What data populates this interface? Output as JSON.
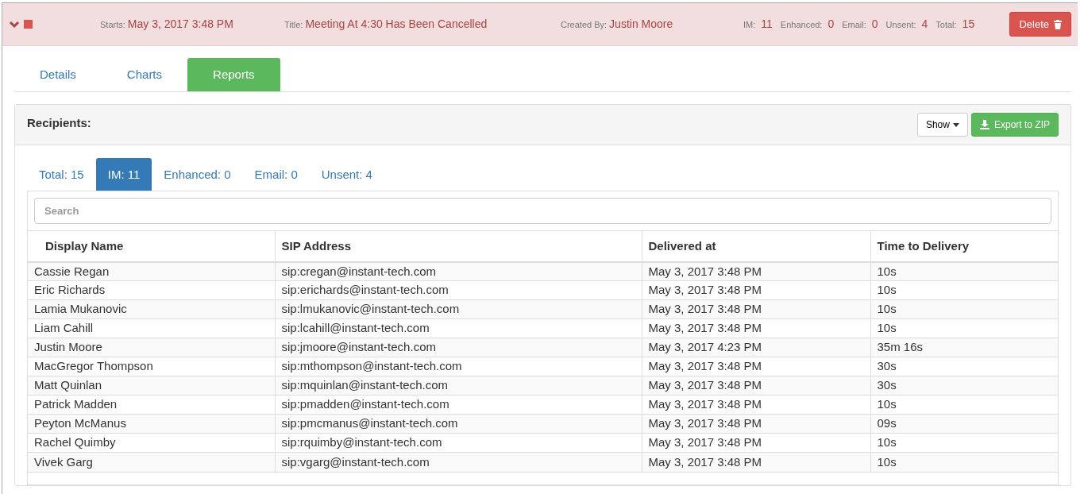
{
  "header": {
    "expanded": true,
    "fields": [
      {
        "label": "Starts:",
        "value": "May 3, 2017 3:48 PM"
      },
      {
        "label": "Title:",
        "value": "Meeting At 4:30 Has Been Cancelled"
      },
      {
        "label": "Created By:",
        "value": "Justin Moore"
      }
    ],
    "counts": [
      {
        "label": "IM:",
        "value": "11"
      },
      {
        "label": "Enhanced:",
        "value": "0"
      },
      {
        "label": "Email:",
        "value": "0"
      },
      {
        "label": "Unsent:",
        "value": "4"
      },
      {
        "label": "Total:",
        "value": "15"
      }
    ],
    "delete_button": "Delete"
  },
  "tabs": [
    {
      "label": "Details",
      "selected": false
    },
    {
      "label": "Charts",
      "selected": false
    },
    {
      "label": "Reports",
      "selected": true
    }
  ],
  "panel": {
    "title": "Recipients:",
    "show_button": "Show",
    "export_button": "Export to ZIP",
    "subtabs": [
      {
        "label": "Total: 15",
        "selected": false
      },
      {
        "label": "IM: 11",
        "selected": true
      },
      {
        "label": "Enhanced: 0",
        "selected": false
      },
      {
        "label": "Email: 0",
        "selected": false
      },
      {
        "label": "Unsent: 4",
        "selected": false
      }
    ],
    "search": {
      "placeholder": "Search"
    },
    "table": {
      "columns": [
        "Display Name",
        "SIP Address",
        "Delivered at",
        "Time to Delivery"
      ],
      "rows": [
        [
          "Cassie Regan",
          "sip:cregan@instant-tech.com",
          "May 3, 2017 3:48 PM",
          "10s"
        ],
        [
          "Eric Richards",
          "sip:erichards@instant-tech.com",
          "May 3, 2017 3:48 PM",
          "10s"
        ],
        [
          "Lamia Mukanovic",
          "sip:lmukanovic@instant-tech.com",
          "May 3, 2017 3:48 PM",
          "10s"
        ],
        [
          "Liam Cahill",
          "sip:lcahill@instant-tech.com",
          "May 3, 2017 3:48 PM",
          "10s"
        ],
        [
          "Justin Moore",
          "sip:jmoore@instant-tech.com",
          "May 3, 2017 4:23 PM",
          "35m 16s"
        ],
        [
          "MacGregor Thompson",
          "sip:mthompson@instant-tech.com",
          "May 3, 2017 3:48 PM",
          "30s"
        ],
        [
          "Matt Quinlan",
          "sip:mquinlan@instant-tech.com",
          "May 3, 2017 3:48 PM",
          "30s"
        ],
        [
          "Patrick Madden",
          "sip:pmadden@instant-tech.com",
          "May 3, 2017 3:48 PM",
          "10s"
        ],
        [
          "Peyton McManus",
          "sip:pmcmanus@instant-tech.com",
          "May 3, 2017 3:48 PM",
          "09s"
        ],
        [
          "Rachel Quimby",
          "sip:rquimby@instant-tech.com",
          "May 3, 2017 3:48 PM",
          "10s"
        ],
        [
          "Vivek Garg",
          "sip:vgarg@instant-tech.com",
          "May 3, 2017 3:48 PM",
          "10s"
        ]
      ]
    }
  }
}
